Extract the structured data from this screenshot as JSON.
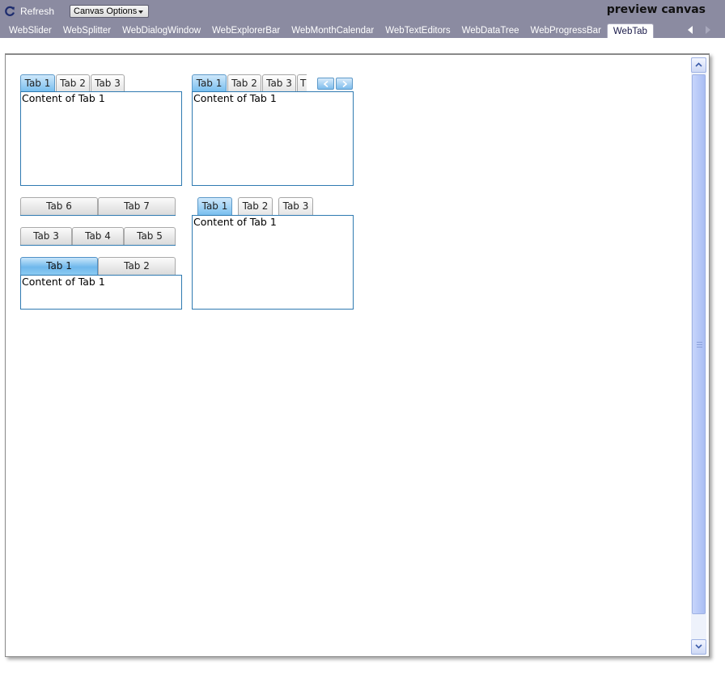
{
  "toolbar": {
    "refresh_label": "Refresh",
    "canvas_options_label": "Canvas Options",
    "title": "preview canvas"
  },
  "nav": {
    "items": [
      {
        "label": "WebSlider",
        "active": false
      },
      {
        "label": "WebSplitter",
        "active": false
      },
      {
        "label": "WebDialogWindow",
        "active": false
      },
      {
        "label": "WebExplorerBar",
        "active": false
      },
      {
        "label": "WebMonthCalendar",
        "active": false
      },
      {
        "label": "WebTextEditors",
        "active": false
      },
      {
        "label": "WebDataTree",
        "active": false
      },
      {
        "label": "WebProgressBar",
        "active": false
      },
      {
        "label": "WebTab",
        "active": true
      }
    ]
  },
  "demo1": {
    "tabs": [
      "Tab 1",
      "Tab 2",
      "Tab 3"
    ],
    "content": "Content of Tab 1"
  },
  "demo2": {
    "tabs": [
      "Tab 1",
      "Tab 2",
      "Tab 3",
      "T"
    ],
    "content": "Content of Tab 1"
  },
  "demo3": {
    "row_top": [
      "Tab 6",
      "Tab 7"
    ],
    "row_mid": [
      "Tab 3",
      "Tab 4",
      "Tab 5"
    ],
    "row_bottom": [
      "Tab 1",
      "Tab 2"
    ],
    "content": "Content of Tab 1"
  },
  "demo4": {
    "tabs": [
      "Tab 1",
      "Tab 2",
      "Tab 3"
    ],
    "content": "Content of Tab 1"
  },
  "colors": {
    "toolbar_bg": "#8b8ba1",
    "panel_border": "#2f7ab1",
    "active_tab": "#79bfef",
    "scrollbar": "#b5c7f7"
  }
}
